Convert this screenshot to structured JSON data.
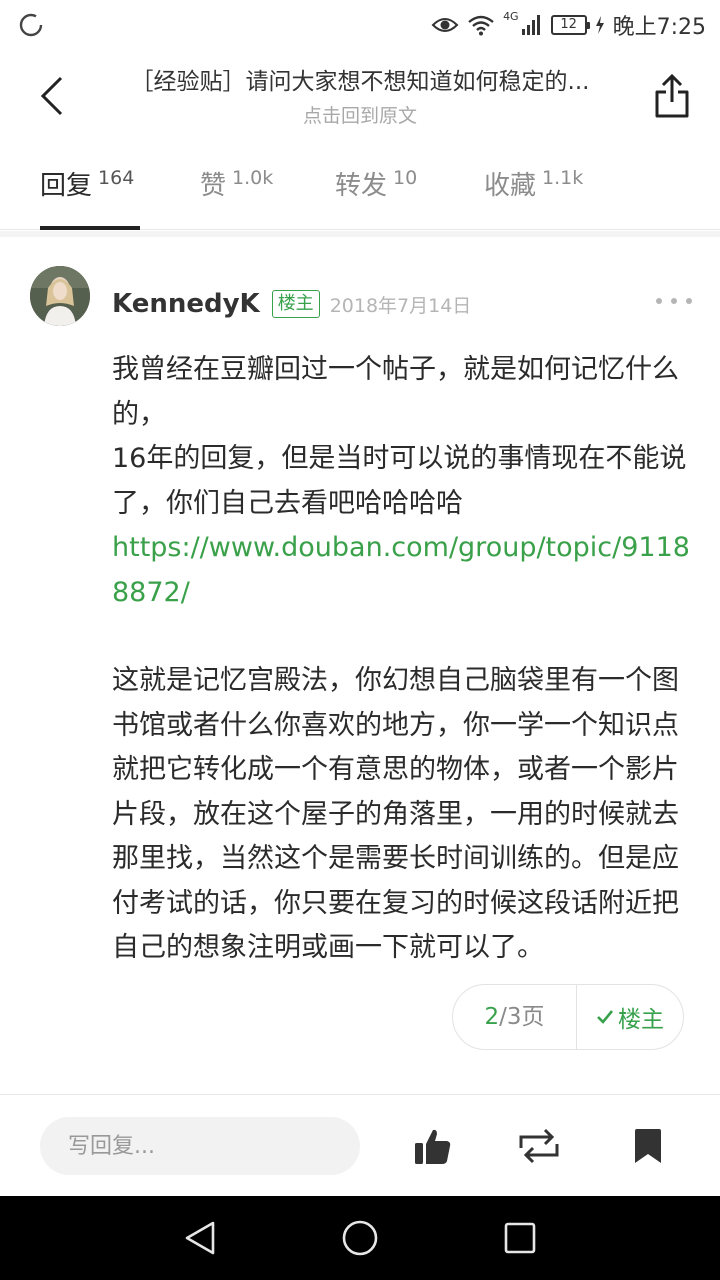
{
  "status_bar": {
    "network": "4G",
    "battery": "12",
    "time": "晚上7:25"
  },
  "header": {
    "title": "［经验贴］请问大家想不想知道如何稳定的...",
    "subtitle": "点击回到原文"
  },
  "tabs": [
    {
      "label": "回复",
      "count": "164",
      "active": true
    },
    {
      "label": "赞",
      "count": "1.0k",
      "active": false
    },
    {
      "label": "转发",
      "count": "10",
      "active": false
    },
    {
      "label": "收藏",
      "count": "1.1k",
      "active": false
    }
  ],
  "post": {
    "author": "KennedyK",
    "op_badge": "楼主",
    "date": "2018年7月14日",
    "para1": "我曾经在豆瓣回过一个帖子，就是如何记忆什么的，",
    "para2": "16年的回复，但是当时可以说的事情现在不能说了，你们自己去看吧哈哈哈哈",
    "link": "https://www.douban.com/group/topic/91188872/",
    "para3": "这就是记忆宫殿法，你幻想自己脑袋里有一个图书馆或者什么你喜欢的地方，你一学一个知识点就把它转化成一个有意思的物体，或者一个影片片段，放在这个屋子的角落里，一用的时候就去那里找，当然这个是需要长时间训练的。但是应付考试的话，你只要在复习的时候这段话附近把自己的想象注明或画一下就可以了。"
  },
  "pager": {
    "current": "2",
    "total": "/3页",
    "op_filter": "楼主"
  },
  "action_bar": {
    "reply_placeholder": "写回复..."
  },
  "colors": {
    "accent_green": "#37a14b",
    "link_green": "#3aa14a"
  }
}
